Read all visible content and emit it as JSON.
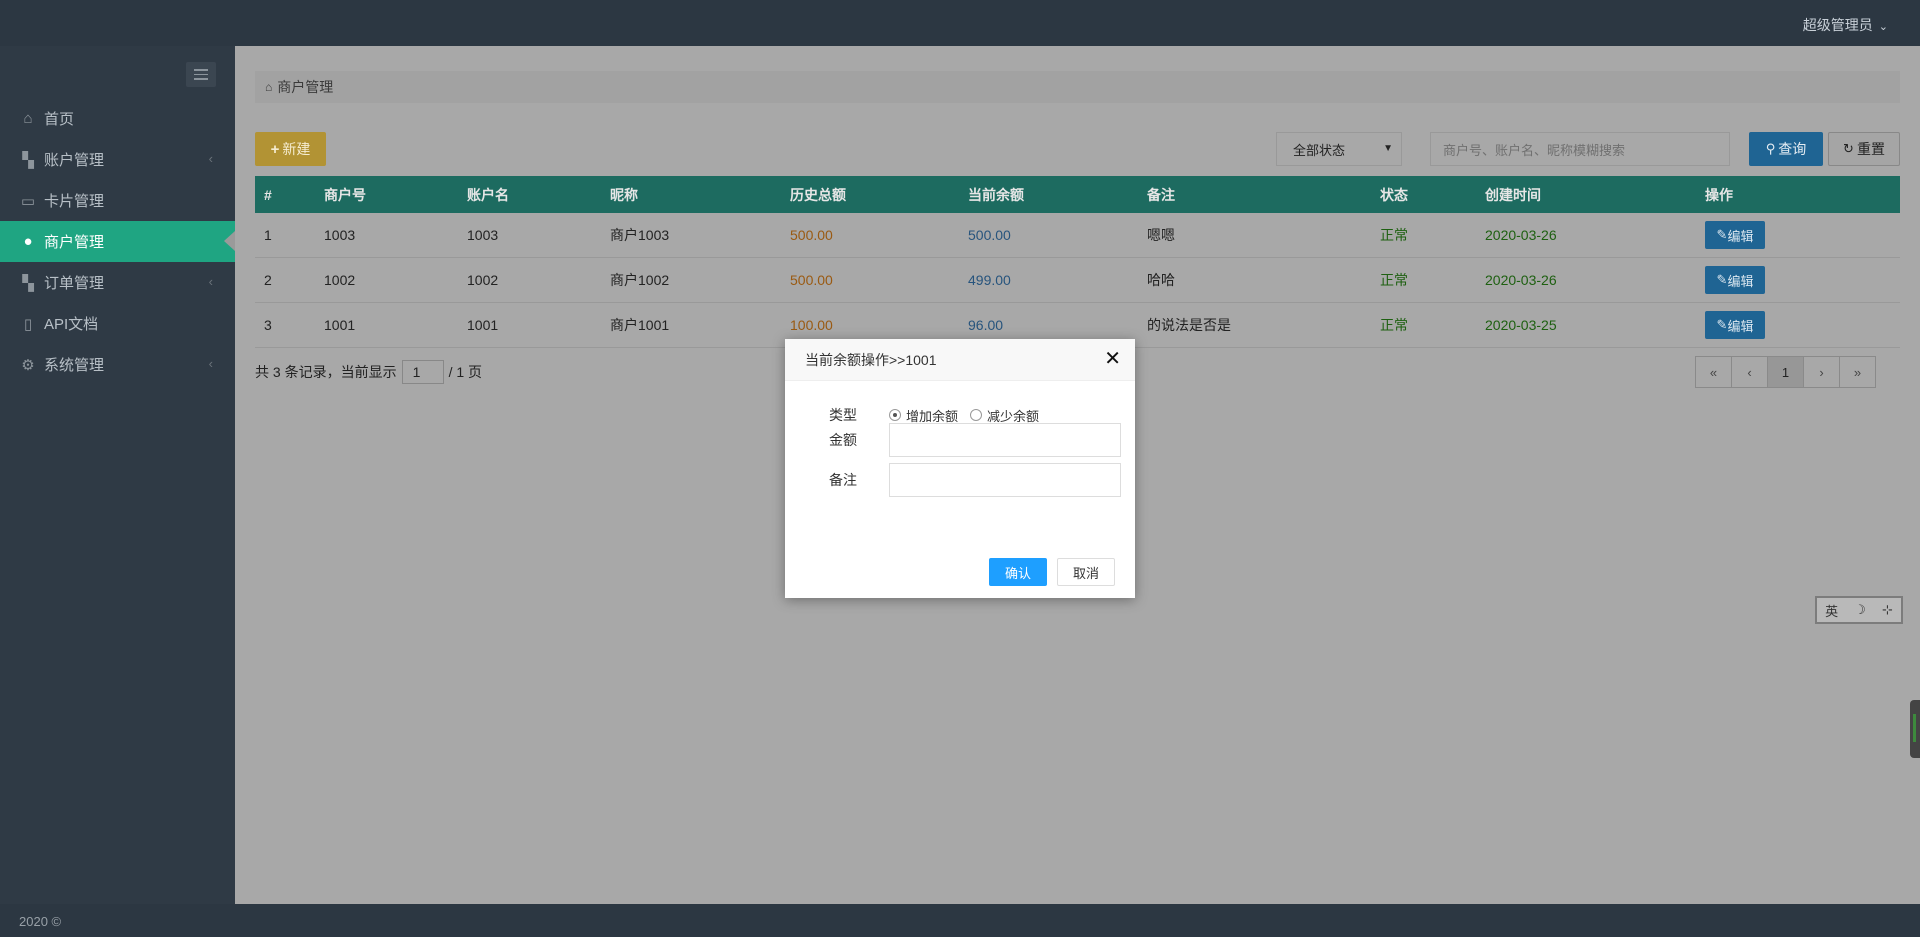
{
  "header": {
    "user_label": "超级管理员"
  },
  "sidebar": {
    "items": [
      {
        "label": "首页",
        "icon": "home-icon",
        "has_arrow": false,
        "active": false
      },
      {
        "label": "账户管理",
        "icon": "blocks-icon",
        "has_arrow": true,
        "active": false
      },
      {
        "label": "卡片管理",
        "icon": "card-icon",
        "has_arrow": false,
        "active": false
      },
      {
        "label": "商户管理",
        "icon": "user-icon",
        "has_arrow": false,
        "active": true
      },
      {
        "label": "订单管理",
        "icon": "blocks-icon",
        "has_arrow": true,
        "active": false
      },
      {
        "label": "API文档",
        "icon": "book-icon",
        "has_arrow": false,
        "active": false
      },
      {
        "label": "系统管理",
        "icon": "gear-icon",
        "has_arrow": true,
        "active": false
      }
    ]
  },
  "footer": {
    "text": "2020 ©"
  },
  "breadcrumb": {
    "label": "商户管理"
  },
  "toolbar": {
    "new_label": "新建",
    "status_select": "全部状态",
    "search_placeholder": "商户号、账户名、昵称模糊搜索",
    "query_label": "查询",
    "reset_label": "重置"
  },
  "table": {
    "columns": [
      "#",
      "商户号",
      "账户名",
      "昵称",
      "历史总额",
      "当前余额",
      "备注",
      "状态",
      "创建时间",
      "操作"
    ],
    "rows": [
      {
        "idx": "1",
        "merchant_no": "1003",
        "account": "1003",
        "nickname": "商户1003",
        "total": "500.00",
        "balance": "500.00",
        "remark": "嗯嗯",
        "status": "正常",
        "created": "2020-03-26",
        "action": "编辑"
      },
      {
        "idx": "2",
        "merchant_no": "1002",
        "account": "1002",
        "nickname": "商户1002",
        "total": "500.00",
        "balance": "499.00",
        "remark": "哈哈",
        "status": "正常",
        "created": "2020-03-26",
        "action": "编辑"
      },
      {
        "idx": "3",
        "merchant_no": "1001",
        "account": "1001",
        "nickname": "商户1001",
        "total": "100.00",
        "balance": "96.00",
        "remark": "的说法是否是",
        "status": "正常",
        "created": "2020-03-25",
        "action": "编辑"
      }
    ]
  },
  "pagination": {
    "prefix": "共 3 条记录，当前显示",
    "current": "1",
    "suffix": "/ 1 页",
    "buttons": [
      "«",
      "‹",
      "1",
      "›",
      "»"
    ]
  },
  "ime": {
    "lang": "英",
    "moon": "☽",
    "mode": "⊹"
  },
  "modal": {
    "title": "当前余额操作>>1001",
    "type_label": "类型",
    "type_options": [
      "增加余额",
      "减少余额"
    ],
    "selected_type": "增加余额",
    "amount_label": "金额",
    "amount_value": "",
    "remark_label": "备注",
    "remark_value": "",
    "confirm_label": "确认",
    "cancel_label": "取消"
  },
  "colors": {
    "accent": "#1fa582",
    "primary": "#1e9fff",
    "table_header": "#26a58f"
  }
}
